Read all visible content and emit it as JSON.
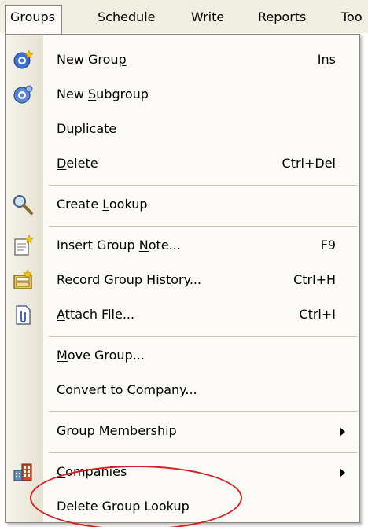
{
  "menubar": {
    "groups": "Groups",
    "schedule": "Schedule",
    "write": "Write",
    "reports": "Reports",
    "tools_partial": "Too"
  },
  "menu": {
    "items": [
      {
        "label": "New Group",
        "shortcut": "Ins",
        "icon": "new-group-icon"
      },
      {
        "label": "New Subgroup",
        "shortcut": "",
        "icon": "new-subgroup-icon"
      },
      {
        "label": "Duplicate",
        "shortcut": ""
      },
      {
        "label": "Delete",
        "shortcut": "Ctrl+Del"
      },
      {
        "label": "Create Lookup",
        "shortcut": "",
        "icon": "magnifier-icon"
      },
      {
        "label": "Insert Group Note...",
        "shortcut": "F9",
        "icon": "note-icon"
      },
      {
        "label": "Record Group History...",
        "shortcut": "Ctrl+H",
        "icon": "history-icon"
      },
      {
        "label": "Attach File...",
        "shortcut": "Ctrl+I",
        "icon": "attach-file-icon"
      },
      {
        "label": "Move Group...",
        "shortcut": ""
      },
      {
        "label": "Convert to Company...",
        "shortcut": ""
      },
      {
        "label": "Group Membership",
        "shortcut": "",
        "submenu": true
      },
      {
        "label": "Companies",
        "shortcut": "",
        "submenu": true,
        "icon": "companies-icon"
      },
      {
        "label": "Delete Group Lookup",
        "shortcut": ""
      }
    ]
  },
  "colors": {
    "menubar_bg": "#f1efe2",
    "menu_bg": "#fbfaf7",
    "border": "#8a867a",
    "separator": "#c5c2b2",
    "annotation": "#d42020"
  }
}
